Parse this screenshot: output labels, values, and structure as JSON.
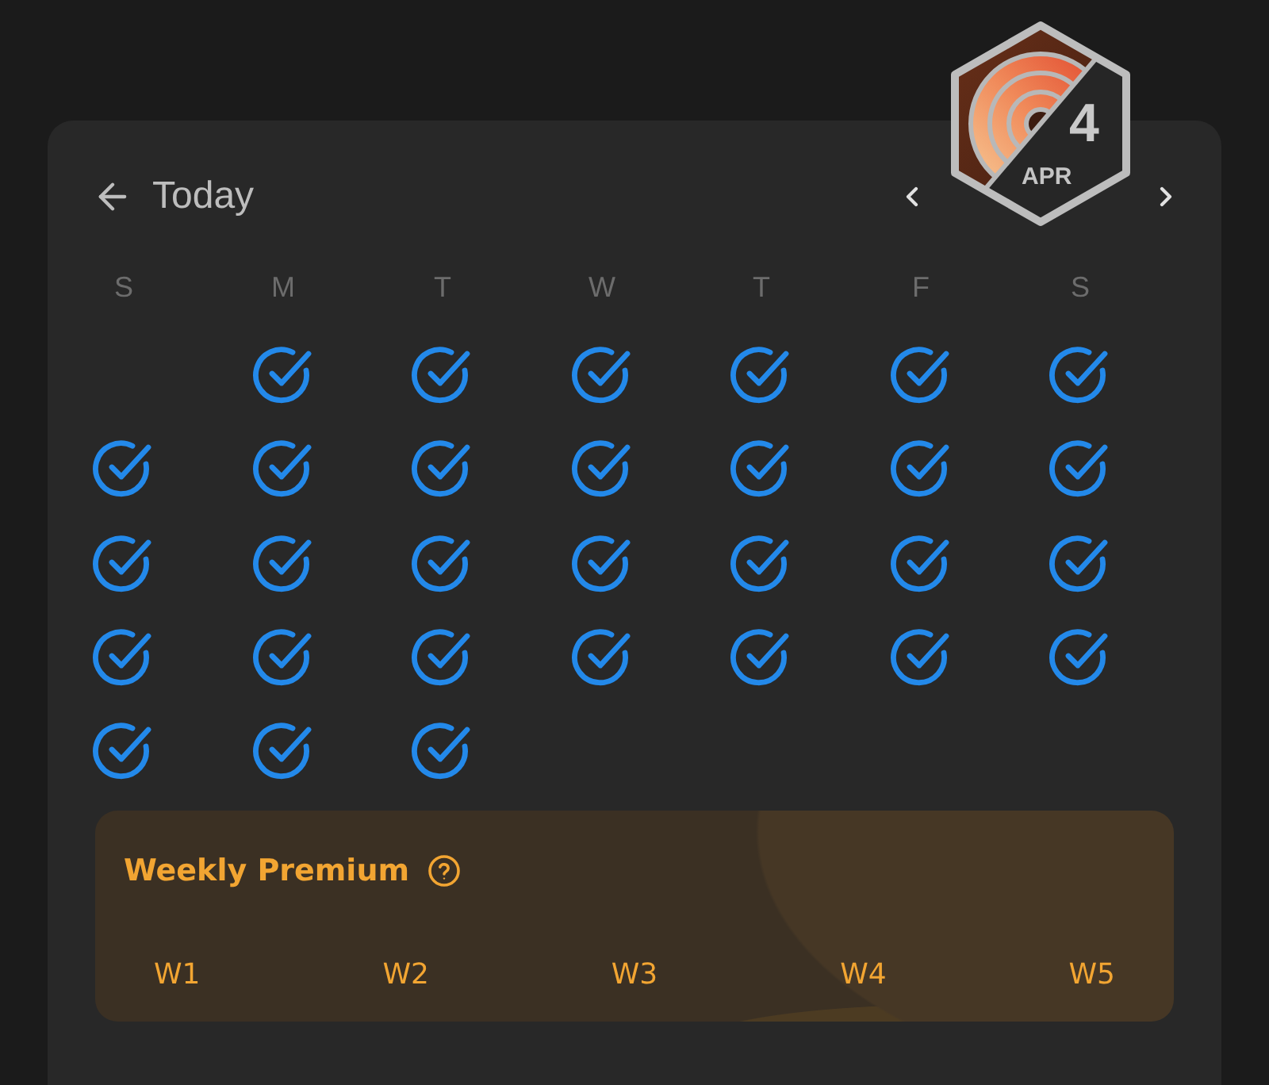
{
  "header": {
    "back_label": "Today",
    "badge": {
      "day": "4",
      "month": "APR"
    }
  },
  "weekdays": [
    "S",
    "M",
    "T",
    "W",
    "T",
    "F",
    "S"
  ],
  "weeks": [
    [
      {
        "kind": "empty"
      },
      {
        "kind": "day",
        "checked": true
      },
      {
        "kind": "day",
        "checked": true
      },
      {
        "kind": "day",
        "checked": true
      },
      {
        "kind": "day",
        "checked": true
      },
      {
        "kind": "day",
        "checked": true
      },
      {
        "kind": "day",
        "checked": true
      }
    ],
    [
      {
        "kind": "day",
        "checked": true
      },
      {
        "kind": "day",
        "checked": true
      },
      {
        "kind": "day",
        "checked": true
      },
      {
        "kind": "day",
        "checked": true
      },
      {
        "kind": "day",
        "checked": true
      },
      {
        "kind": "day",
        "checked": true
      },
      {
        "kind": "day",
        "checked": true
      }
    ],
    [
      {
        "kind": "day",
        "checked": true
      },
      {
        "kind": "day",
        "checked": true
      },
      {
        "kind": "day",
        "checked": true
      },
      {
        "kind": "day",
        "checked": true
      },
      {
        "kind": "day",
        "checked": true
      },
      {
        "kind": "day",
        "checked": true
      },
      {
        "kind": "day",
        "checked": true
      }
    ],
    [
      {
        "kind": "day",
        "checked": true
      },
      {
        "kind": "day",
        "checked": true
      },
      {
        "kind": "day",
        "checked": true
      },
      {
        "kind": "day",
        "checked": true
      },
      {
        "kind": "day",
        "checked": true
      },
      {
        "kind": "day",
        "checked": true
      },
      {
        "kind": "day",
        "checked": true
      }
    ],
    [
      {
        "kind": "day",
        "checked": true
      },
      {
        "kind": "day",
        "checked": true
      },
      {
        "kind": "day",
        "checked": true
      }
    ]
  ],
  "premium": {
    "title": "Weekly Premium",
    "weeks": [
      "W1",
      "W2",
      "W3",
      "W4",
      "W5"
    ]
  }
}
